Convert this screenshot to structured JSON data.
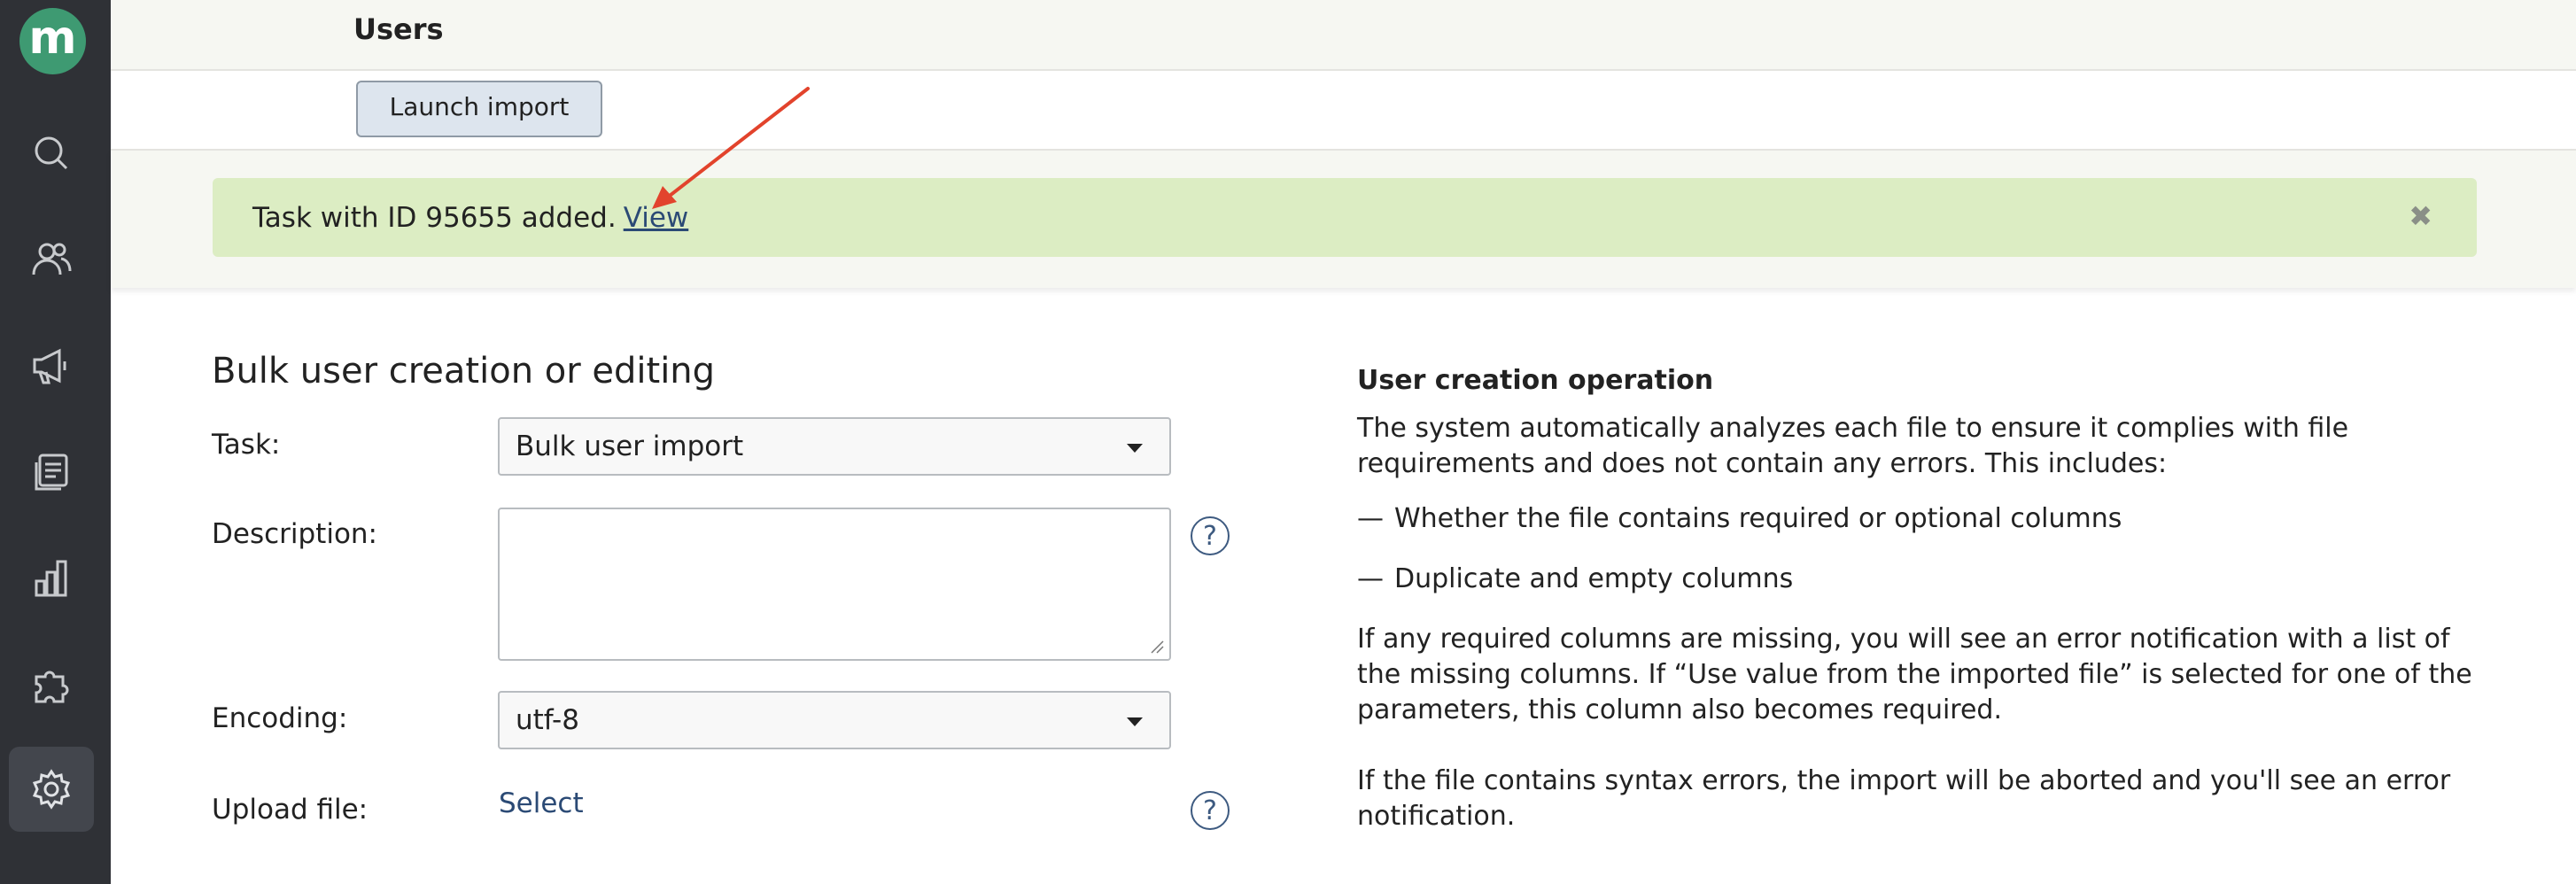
{
  "app": {
    "logo_letter": "m",
    "accent_color": "#3e9a72",
    "sidebar_items": [
      {
        "name": "search",
        "icon": "search-icon"
      },
      {
        "name": "users",
        "icon": "users-icon"
      },
      {
        "name": "announcements",
        "icon": "megaphone-icon"
      },
      {
        "name": "courses",
        "icon": "documents-icon"
      },
      {
        "name": "reports",
        "icon": "bar-chart-icon"
      },
      {
        "name": "extensions",
        "icon": "puzzle-icon"
      },
      {
        "name": "settings",
        "icon": "gear-icon",
        "active": true
      }
    ]
  },
  "header": {
    "title": "Users",
    "launch_button": "Launch import"
  },
  "notification": {
    "text": "Task with ID 95655 added.",
    "link": "View",
    "close": "✖"
  },
  "form": {
    "title": "Bulk user creation or editing",
    "task_label": "Task:",
    "task_value": "Bulk user import",
    "description_label": "Description:",
    "encoding_label": "Encoding:",
    "encoding_value": "utf-8",
    "upload_label": "Upload file:",
    "upload_link": "Select",
    "help_glyph": "?"
  },
  "info": {
    "title": "User creation operation",
    "intro": "The system automatically analyzes each file to ensure it complies with file requirements and does not contain any errors. This includes:",
    "bullets": [
      "Whether the file contains required or optional columns",
      "Duplicate and empty columns"
    ],
    "dash": "—",
    "para_required": "If any required columns are missing, you will see an error notification with a list of the missing columns. If “Use value from the imported file” is selected for one of the parameters, this column also becomes required.",
    "para_syntax": "If the file contains syntax errors, the import will be aborted and you'll see an error notification."
  }
}
